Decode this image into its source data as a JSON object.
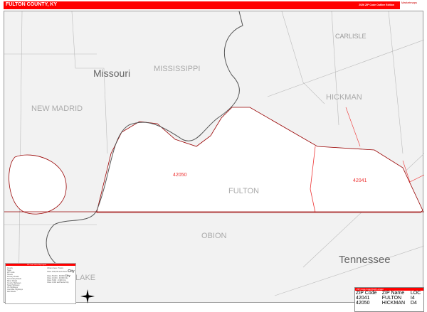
{
  "header": {
    "title": "FULTON COUNTY, KY",
    "edition": "2026 ZIP Code Outline Edition",
    "logo": "Marketmaps"
  },
  "map": {
    "labels": {
      "carlisle": "CARLISLE",
      "missouri": "Missouri",
      "mississippi": "MISSISSIPPI",
      "hickman": "HICKMAN",
      "new_madrid": "NEW MADRID",
      "fulton": "FULTON",
      "obion": "OBION",
      "tennessee": "Tennessee",
      "lake": "LAKE",
      "zip1": "42050",
      "zip2": "42041"
    },
    "colors": {
      "zip": "#e33",
      "county": "#900",
      "header": "#ff0000"
    }
  },
  "legend": {
    "title": "ZIP Code Outline Map Legend",
    "rows": [
      "County",
      "State",
      "ZIP Code",
      "Streets",
      "Primary Roads",
      "Secondary Roads",
      "Minor Roads",
      "County Highways",
      "State Highways",
      "US Highways",
      "Interstate Highways",
      "Rail Roads"
    ],
    "cities_title": "Urban Areas / Towns",
    "cities": [
      "Cities 100,000 and Above",
      "Cities 50,000 - 99,999",
      "Cities 10,000 - 49,999",
      "Cities 5,000 - 9,999",
      "Cities 1,000 and Below"
    ],
    "samples": [
      "City",
      "City",
      "City",
      "City",
      "City"
    ]
  },
  "zip_table": {
    "title": "ZIP Code Index/Grid Locator",
    "headers": [
      "ZIP Code",
      "ZIP Name",
      "LOC"
    ],
    "rows": [
      [
        "42041",
        "FULTON",
        "I4"
      ],
      [
        "42050",
        "HICKMAN",
        "D4"
      ]
    ]
  }
}
